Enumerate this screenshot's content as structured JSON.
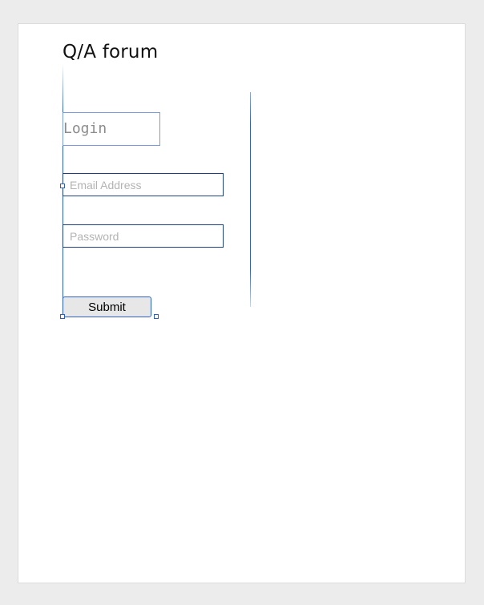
{
  "page": {
    "title": "Q/A forum"
  },
  "form": {
    "login_label": "Login",
    "email": {
      "placeholder": "Email Address",
      "value": ""
    },
    "password": {
      "placeholder": "Password",
      "value": ""
    },
    "submit_label": "Submit"
  },
  "colors": {
    "background": "#ececec",
    "page": "#ffffff",
    "selection_outline": "#2f5fbf",
    "field_border": "#1f3f86",
    "button_fill": "#e7e7e7"
  }
}
